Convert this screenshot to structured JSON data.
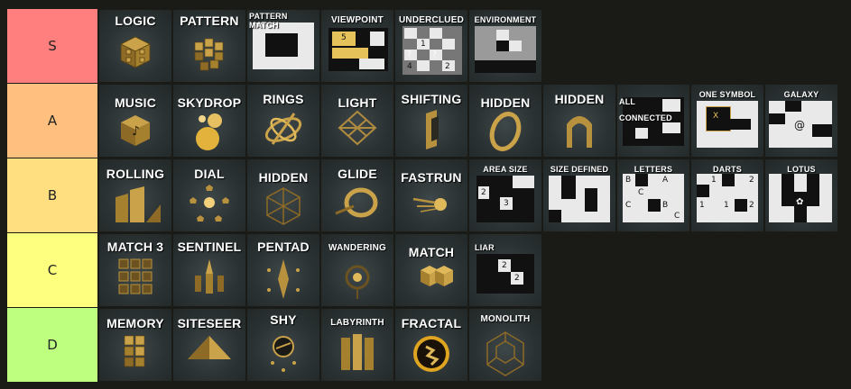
{
  "tiers": [
    {
      "label": "S",
      "color": "#ff7f7f",
      "items": [
        "LOGIC",
        "PATTERN",
        "PATTERN MATCH",
        "VIEWPOINT",
        "UNDERCLUED",
        "ENVIRONMENT"
      ]
    },
    {
      "label": "A",
      "color": "#ffbf7f",
      "items": [
        "MUSIC",
        "SKYDROP",
        "RINGS",
        "LIGHT",
        "SHIFTING",
        "HIDDEN",
        "HIDDEN",
        "ALL CONNECTED",
        "ONE SYMBOL",
        "GALAXY"
      ]
    },
    {
      "label": "B",
      "color": "#ffdf7f",
      "items": [
        "ROLLING",
        "DIAL",
        "HIDDEN",
        "GLIDE",
        "FASTRUN",
        "AREA SIZE",
        "SIZE DEFINED",
        "LETTERS",
        "DARTS",
        "LOTUS"
      ]
    },
    {
      "label": "C",
      "color": "#ffff7f",
      "items": [
        "MATCH 3",
        "SENTINEL",
        "PENTAD",
        "WANDERING",
        "MATCH",
        "LIAR"
      ]
    },
    {
      "label": "D",
      "color": "#bfff7f",
      "items": [
        "MEMORY",
        "SITESEER",
        "SHY",
        "LABYRINTH",
        "FRACTAL",
        "MONOLITH"
      ]
    }
  ],
  "icons": {
    "S": [
      "logic-cube-icon",
      "pattern-cubes-icon",
      "pattern-match-grid-icon",
      "viewpoint-grid-icon",
      "underclued-grid-icon",
      "environment-grid-icon"
    ],
    "A": [
      "music-note-cube-icon",
      "skydrop-orbs-icon",
      "rings-icon",
      "light-lattice-icon",
      "shifting-prism-icon",
      "hidden-ring-icon",
      "hidden-arch-icon",
      "all-connected-grid-icon",
      "one-symbol-grid-icon",
      "galaxy-grid-icon"
    ],
    "B": [
      "rolling-slabs-icon",
      "dial-pentagons-icon",
      "hidden-cube-icon",
      "glide-ring-icon",
      "fastrun-comet-icon",
      "area-size-grid-icon",
      "size-defined-grid-icon",
      "letters-grid-icon",
      "darts-grid-icon",
      "lotus-grid-icon"
    ],
    "C": [
      "match3-tiles-icon",
      "sentinel-spires-icon",
      "pentad-shard-icon",
      "wandering-orb-icon",
      "match-cubes-icon",
      "liar-grid-icon"
    ],
    "D": [
      "memory-cubes-icon",
      "siteseer-pyramid-icon",
      "shy-orb-icon",
      "labyrinth-panels-icon",
      "fractal-sun-icon",
      "monolith-cube-icon"
    ]
  },
  "puzzle_numbers": {
    "underclued": [
      "1",
      "?",
      "?",
      "4",
      "2"
    ],
    "viewpoint": [
      "5"
    ],
    "one_symbol": [
      "X"
    ],
    "area_size": [
      "2",
      "3"
    ],
    "letters": [
      "B",
      "A",
      "C",
      "C",
      "B",
      "C"
    ],
    "darts": [
      "1",
      "2",
      "1",
      "1",
      "2"
    ],
    "liar": [
      "2",
      "2"
    ]
  },
  "colors": {
    "gold": "#c9a24a",
    "tile_bg": "#2b3233",
    "board_bg": "#1a1a17"
  }
}
